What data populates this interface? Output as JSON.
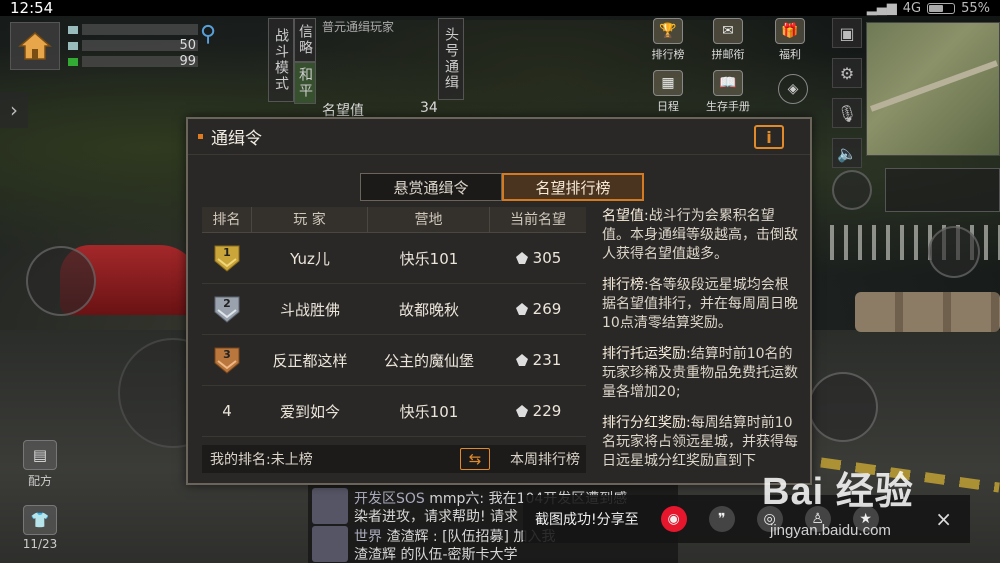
{
  "status_bar": {
    "time": "12:54",
    "network": "4G",
    "battery": "55%"
  },
  "hud": {
    "stats": [
      {
        "value": ""
      },
      {
        "value": "50"
      },
      {
        "value": "99"
      }
    ],
    "vertical_tabs": [
      "战斗模式",
      "和平",
      "信略",
      "头号通缉"
    ],
    "top_notice": "普元通缉玩家",
    "fame_label": "名望值",
    "fame_value": "34",
    "top_icons": [
      {
        "label": "排行榜",
        "glyph": "🏆"
      },
      {
        "label": "拼邮衔",
        "glyph": "✉"
      },
      {
        "label": "福利",
        "glyph": "🎁"
      },
      {
        "label": "日程",
        "glyph": "▦"
      },
      {
        "label": "生存手册",
        "glyph": "📖"
      }
    ],
    "bottom_left": [
      {
        "label": "配方",
        "glyph": "▤"
      },
      {
        "label": "11/23",
        "glyph": "👕"
      }
    ]
  },
  "modal": {
    "title": "通缉令",
    "info_label": "i",
    "tabs": [
      {
        "label": "悬赏通缉令",
        "active": false
      },
      {
        "label": "名望排行榜",
        "active": true
      }
    ],
    "columns": [
      "排名",
      "玩 家",
      "营地",
      "当前名望"
    ],
    "rows": [
      {
        "rank": "1",
        "player": "Yuz儿",
        "camp": "快乐101",
        "fame": "305",
        "badge": "gold"
      },
      {
        "rank": "2",
        "player": "斗战胜佛",
        "camp": "故都晚秋",
        "fame": "269",
        "badge": "silver"
      },
      {
        "rank": "3",
        "player": "反正都这样",
        "camp": "公主的魔仙堡",
        "fame": "231",
        "badge": "bronze"
      },
      {
        "rank": "4",
        "player": "爱到如今",
        "camp": "快乐101",
        "fame": "229",
        "badge": "none"
      }
    ],
    "my_rank": "我的排名:未上榜",
    "switch_label": "本周排行榜",
    "description": [
      {
        "head": "名望值:",
        "body": "战斗行为会累积名望值。本身通缉等级越高，击倒敌人获得名望值越多。"
      },
      {
        "head": "排行榜:",
        "body": "各等级段远星城均会根据名望值排行，并在每周周日晚10点清零结算奖励。"
      },
      {
        "head": "排行托运奖励:",
        "body": "结算时前10名的玩家珍稀及贵重物品免费托运数量各增加20;"
      },
      {
        "head": "排行分红奖励:",
        "body": "每周结算时前10名玩家将占领远星城，并获得每日远星城分红奖励直到下"
      }
    ]
  },
  "chat": [
    {
      "channel": "开发区SOS",
      "text": "mmp六: 我在104开发区遭到感"
    },
    {
      "channel": "",
      "text": "染者进攻，请求帮助! 请求"
    },
    {
      "channel": "世界",
      "text": "渣渣辉 : [队伍招募] 加入我"
    },
    {
      "channel": "",
      "text": "渣渣辉 的队伍-密斯卡大学"
    }
  ],
  "share": {
    "label": "截图成功!分享至",
    "targets": [
      "weibo-icon",
      "wechat-icon",
      "moments-icon",
      "qq-icon",
      "qzone-icon"
    ],
    "close": "×"
  },
  "watermark": {
    "brand": "Bai 经验",
    "url": "jingyan.baidu.com"
  },
  "colors": {
    "accent": "#e08a2a",
    "panel": "#2a2826",
    "gold": "#c9a53a",
    "silver": "#9aa3ad",
    "bronze": "#b9773e"
  }
}
